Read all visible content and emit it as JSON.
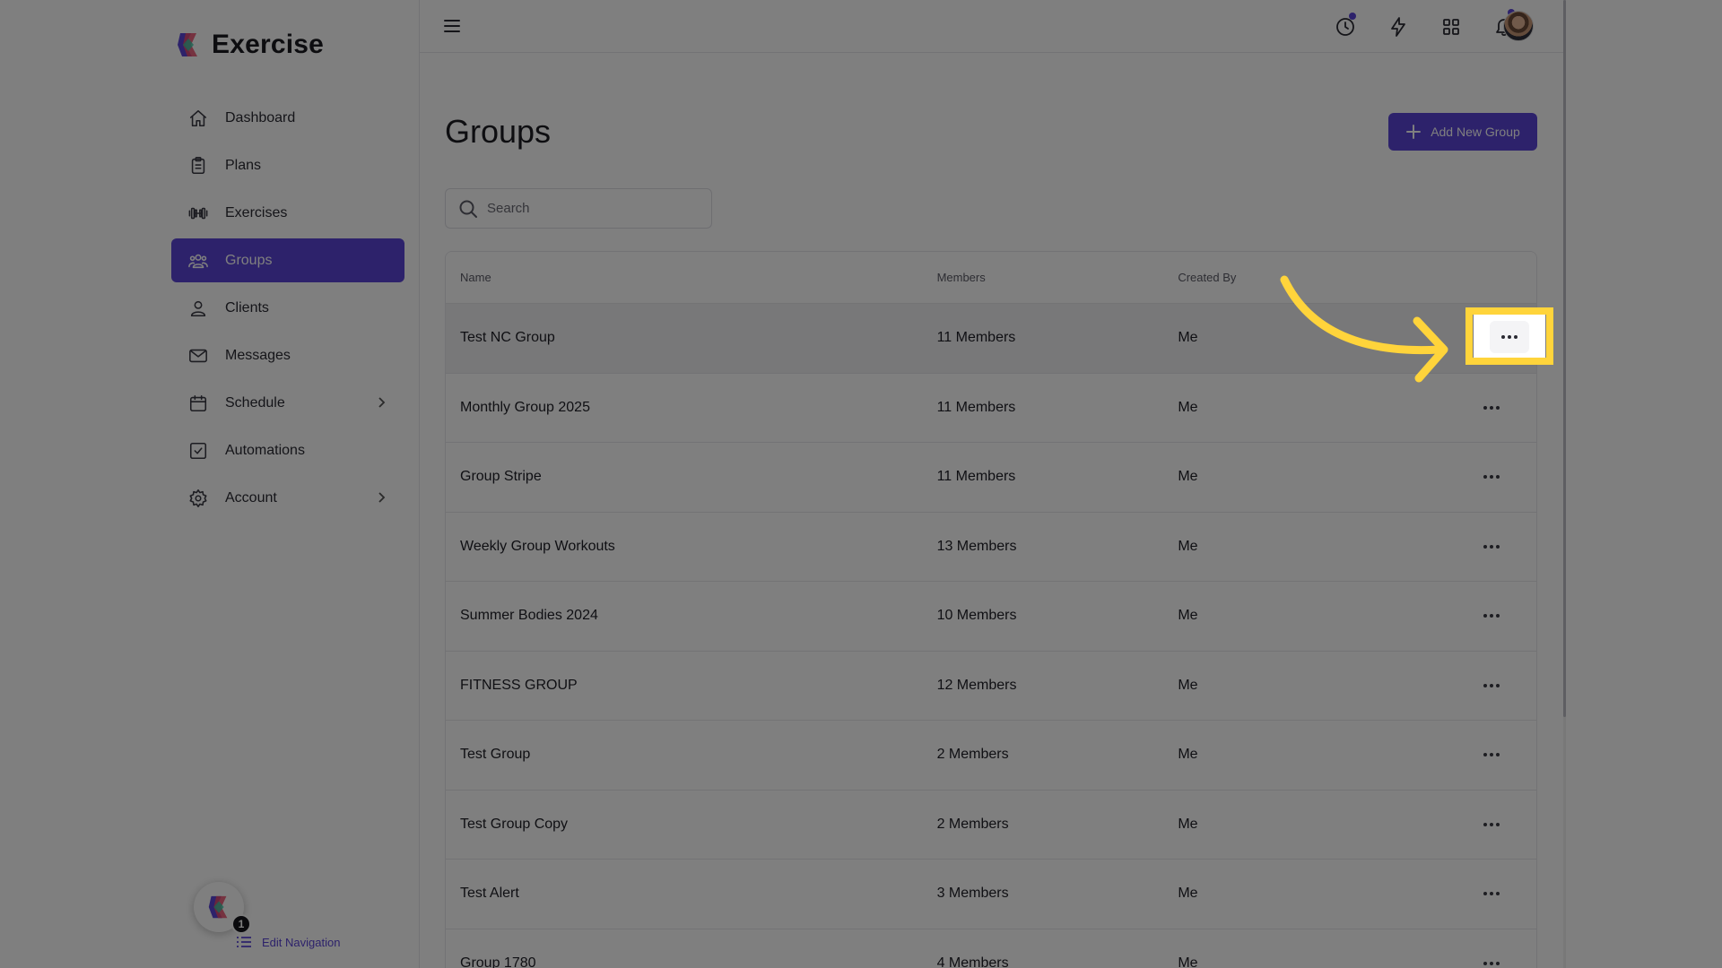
{
  "brand": {
    "name": "Exercise"
  },
  "sidebar": {
    "items": [
      {
        "label": "Dashboard",
        "icon": "home-icon",
        "has_chevron": false,
        "active": false
      },
      {
        "label": "Plans",
        "icon": "clipboard-icon",
        "has_chevron": false,
        "active": false
      },
      {
        "label": "Exercises",
        "icon": "dumbbell-icon",
        "has_chevron": false,
        "active": false
      },
      {
        "label": "Groups",
        "icon": "users-icon",
        "has_chevron": false,
        "active": true
      },
      {
        "label": "Clients",
        "icon": "user-icon",
        "has_chevron": false,
        "active": false
      },
      {
        "label": "Messages",
        "icon": "mail-icon",
        "has_chevron": false,
        "active": false
      },
      {
        "label": "Schedule",
        "icon": "calendar-icon",
        "has_chevron": true,
        "active": false
      },
      {
        "label": "Automations",
        "icon": "checkbox-icon",
        "has_chevron": false,
        "active": false
      },
      {
        "label": "Account",
        "icon": "gear-icon",
        "has_chevron": true,
        "active": false
      }
    ],
    "fab_badge": "1",
    "edit_navigation_label": "Edit Navigation"
  },
  "topbar": {
    "icons": [
      "clock-icon",
      "lightning-icon",
      "grid-icon",
      "bell-icon"
    ]
  },
  "main": {
    "title": "Groups",
    "add_button_label": "Add New Group",
    "search_placeholder": "Search",
    "table": {
      "headers": {
        "name": "Name",
        "members": "Members",
        "created_by": "Created By"
      },
      "rows": [
        {
          "name": "Test NC Group",
          "members": "11 Members",
          "created_by": "Me"
        },
        {
          "name": "Monthly Group 2025",
          "members": "11 Members",
          "created_by": "Me"
        },
        {
          "name": "Group Stripe",
          "members": "11 Members",
          "created_by": "Me"
        },
        {
          "name": "Weekly Group Workouts",
          "members": "13 Members",
          "created_by": "Me"
        },
        {
          "name": "Summer Bodies 2024",
          "members": "10 Members",
          "created_by": "Me"
        },
        {
          "name": "FITNESS GROUP",
          "members": "12 Members",
          "created_by": "Me"
        },
        {
          "name": "Test Group",
          "members": "2 Members",
          "created_by": "Me"
        },
        {
          "name": "Test Group Copy",
          "members": "2 Members",
          "created_by": "Me"
        },
        {
          "name": "Test Alert",
          "members": "3 Members",
          "created_by": "Me"
        },
        {
          "name": "Group 1780",
          "members": "4 Members",
          "created_by": "Me"
        }
      ]
    }
  },
  "colors": {
    "accent": "#5a44d6",
    "highlight": "#ffd43b"
  }
}
